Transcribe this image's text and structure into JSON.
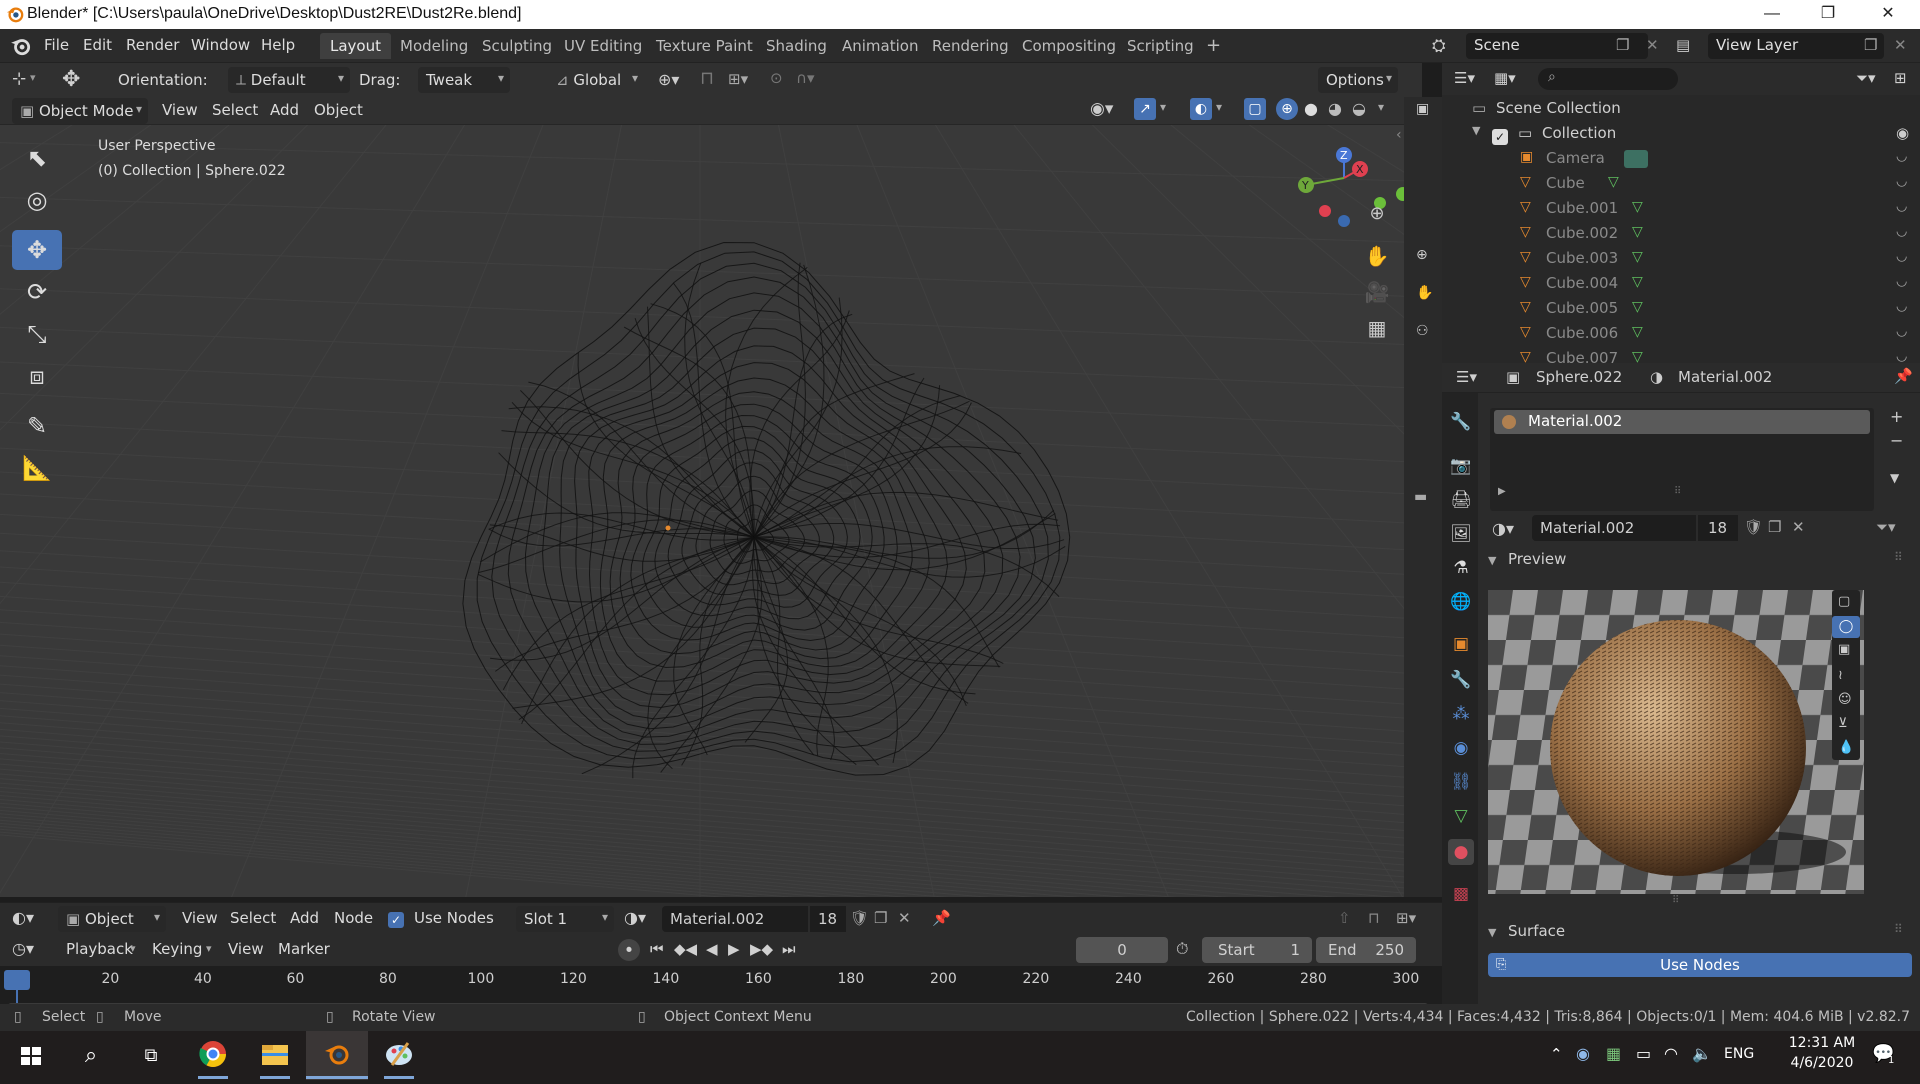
{
  "window": {
    "title": "Blender* [C:\\Users\\paula\\OneDrive\\Desktop\\Dust2RE\\Dust2Re.blend]",
    "min_label": "—",
    "max_label": "❐",
    "close_label": "✕"
  },
  "menu": {
    "items": [
      "File",
      "Edit",
      "Render",
      "Window",
      "Help"
    ],
    "workspaces": [
      "Layout",
      "Modeling",
      "Sculpting",
      "UV Editing",
      "Texture Paint",
      "Shading",
      "Animation",
      "Rendering",
      "Compositing",
      "Scripting"
    ],
    "active_workspace": "Layout",
    "add_tab": "+",
    "scene": "Scene",
    "view_layer": "View Layer"
  },
  "tool_header": {
    "orientation_label": "Orientation:",
    "orientation_value": "Default",
    "drag_label": "Drag:",
    "drag_value": "Tweak",
    "transform_value": "Global",
    "options_label": "Options"
  },
  "viewport_header": {
    "mode": "Object Mode",
    "menus": [
      "View",
      "Select",
      "Add",
      "Object"
    ]
  },
  "viewport": {
    "perspective_label": "User Perspective",
    "collection_label": "(0) Collection | Sphere.022",
    "gizmo": {
      "x": "X",
      "y": "Y",
      "z": "Z"
    },
    "grid_color": "#3f3f3f",
    "background_color": "#393939"
  },
  "outliner": {
    "search_placeholder": "",
    "root": "Scene Collection",
    "collection": "Collection",
    "items": [
      "Camera",
      "Cube",
      "Cube.001",
      "Cube.002",
      "Cube.003",
      "Cube.004",
      "Cube.005",
      "Cube.006",
      "Cube.007"
    ]
  },
  "properties": {
    "object_name": "Sphere.022",
    "material_name": "Material.002",
    "slot_material": "Material.002",
    "datablock_name": "Material.002",
    "user_count": "18",
    "preview_label": "Preview",
    "surface_label": "Surface",
    "use_nodes_button": "Use Nodes"
  },
  "node_header": {
    "editor": "Object",
    "menus": [
      "View",
      "Select",
      "Add",
      "Node"
    ],
    "use_nodes_label": "Use Nodes",
    "slot": "Slot 1",
    "material": "Material.002",
    "user_count": "18"
  },
  "timeline": {
    "playback": "Playback",
    "keying": "Keying",
    "view": "View",
    "marker": "Marker",
    "current_frame": "0",
    "start_label": "Start",
    "start_value": "1",
    "end_label": "End",
    "end_value": "250",
    "ruler": [
      "0",
      "20",
      "40",
      "60",
      "80",
      "100",
      "120",
      "140",
      "160",
      "180",
      "200",
      "220",
      "240",
      "260",
      "280",
      "300"
    ]
  },
  "statusbar": {
    "select": "Select",
    "move": "Move",
    "rotate": "Rotate View",
    "context": "Object Context Menu",
    "stats": "Collection | Sphere.022 | Verts:4,434 | Faces:4,432 | Tris:8,864 | Objects:0/1 | Mem: 404.6 MiB | v2.82.7"
  },
  "taskbar": {
    "language": "ENG",
    "time": "12:31 AM",
    "date": "4/6/2020",
    "notifications": "1"
  },
  "colors": {
    "accent_blue": "#4772b3",
    "object_orange": "#e68a2e",
    "mesh_green": "#5fbf5f"
  }
}
